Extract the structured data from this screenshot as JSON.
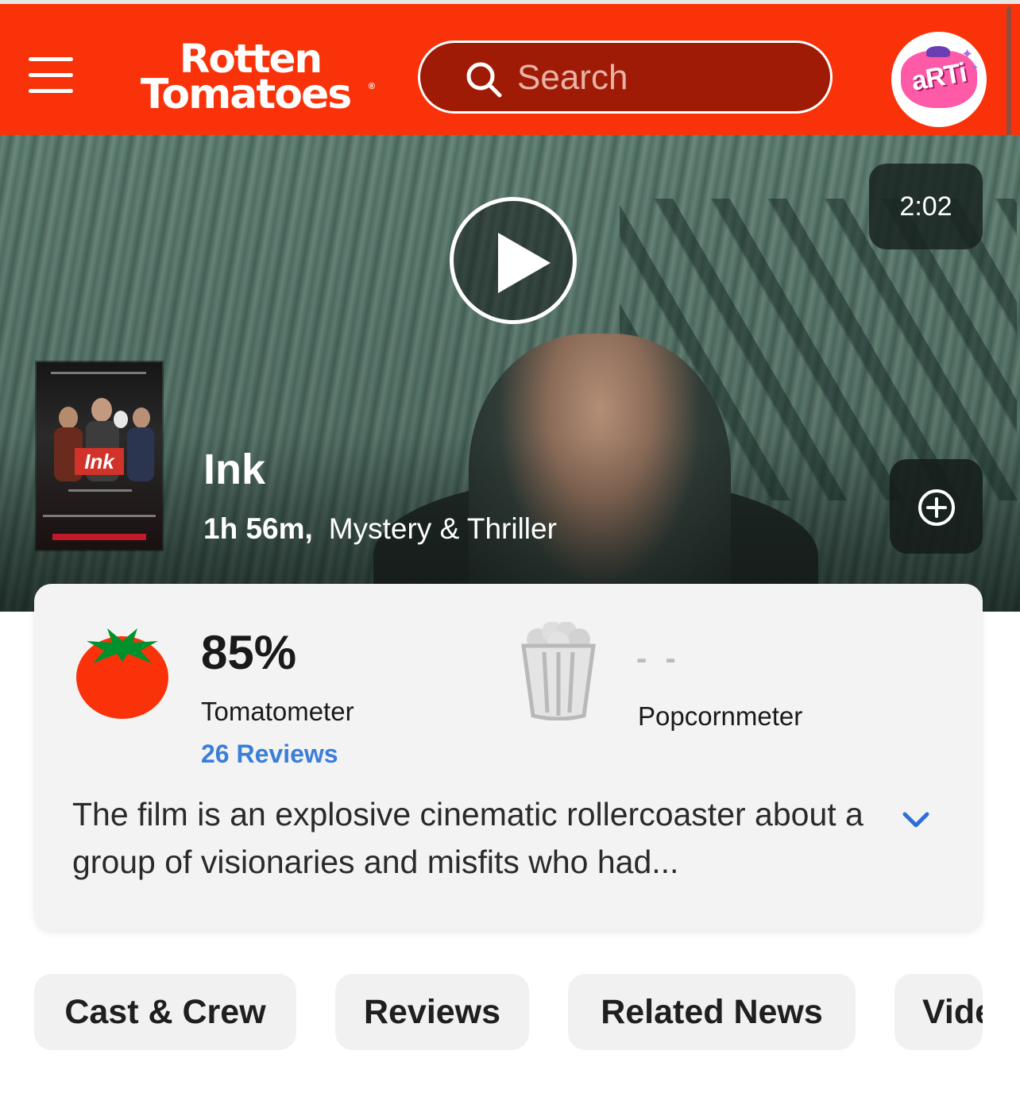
{
  "header": {
    "logo_line1": "Rotten",
    "logo_line2": "Tomatoes",
    "logo_registered": "®",
    "search_placeholder": "Search",
    "avatar_text": "aRTi",
    "brand_color": "#fa320a"
  },
  "hero": {
    "trailer_duration": "2:02",
    "movie_title": "Ink",
    "runtime": "1h 56m,",
    "genre": "Mystery & Thriller",
    "poster_title": "Ink"
  },
  "scores": {
    "tomatometer_score": "85%",
    "tomatometer_label": "Tomatometer",
    "reviews_link": "26 Reviews",
    "popcornmeter_score": "- -",
    "popcornmeter_label": "Popcornmeter",
    "link_color": "#3b7ed8"
  },
  "synopsis": {
    "text": "The film is an explosive cinematic rollercoaster about a group of visionaries and misfits who had..."
  },
  "tabs": [
    {
      "label": "Cast & Crew"
    },
    {
      "label": "Reviews"
    },
    {
      "label": "Related News"
    },
    {
      "label": "Videos"
    }
  ],
  "icons": {
    "menu": "hamburger-icon",
    "search": "search-icon",
    "play": "play-icon",
    "add": "plus-circle-icon",
    "tomatometer": "fresh-tomato-icon",
    "popcornmeter": "popcorn-bucket-icon",
    "expand": "chevron-down-icon"
  }
}
